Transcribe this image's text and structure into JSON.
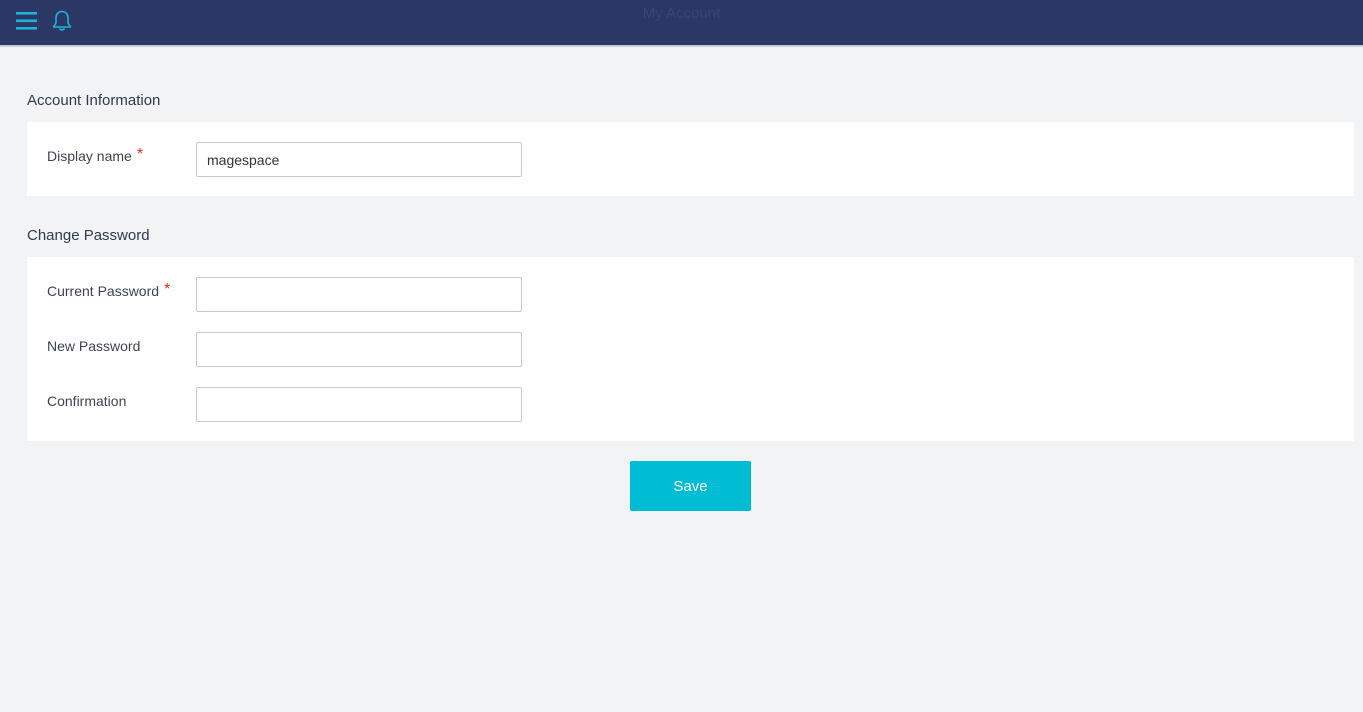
{
  "header": {
    "title": "My Account",
    "menu_icon": "hamburger-menu-icon",
    "notification_icon": "bell-icon"
  },
  "account_information": {
    "title": "Account Information",
    "display_name": {
      "label": "Display name",
      "required_mark": "*",
      "value": "magespace"
    }
  },
  "change_password": {
    "title": "Change Password",
    "current_password": {
      "label": "Current Password",
      "required_mark": "*",
      "value": ""
    },
    "new_password": {
      "label": "New Password",
      "value": ""
    },
    "confirmation": {
      "label": "Confirmation",
      "value": ""
    }
  },
  "actions": {
    "save_label": "Save"
  },
  "colors": {
    "header_bg": "#2b3765",
    "accent": "#00bcd4",
    "page_bg": "#f2f3f5",
    "required": "#e02b27"
  }
}
